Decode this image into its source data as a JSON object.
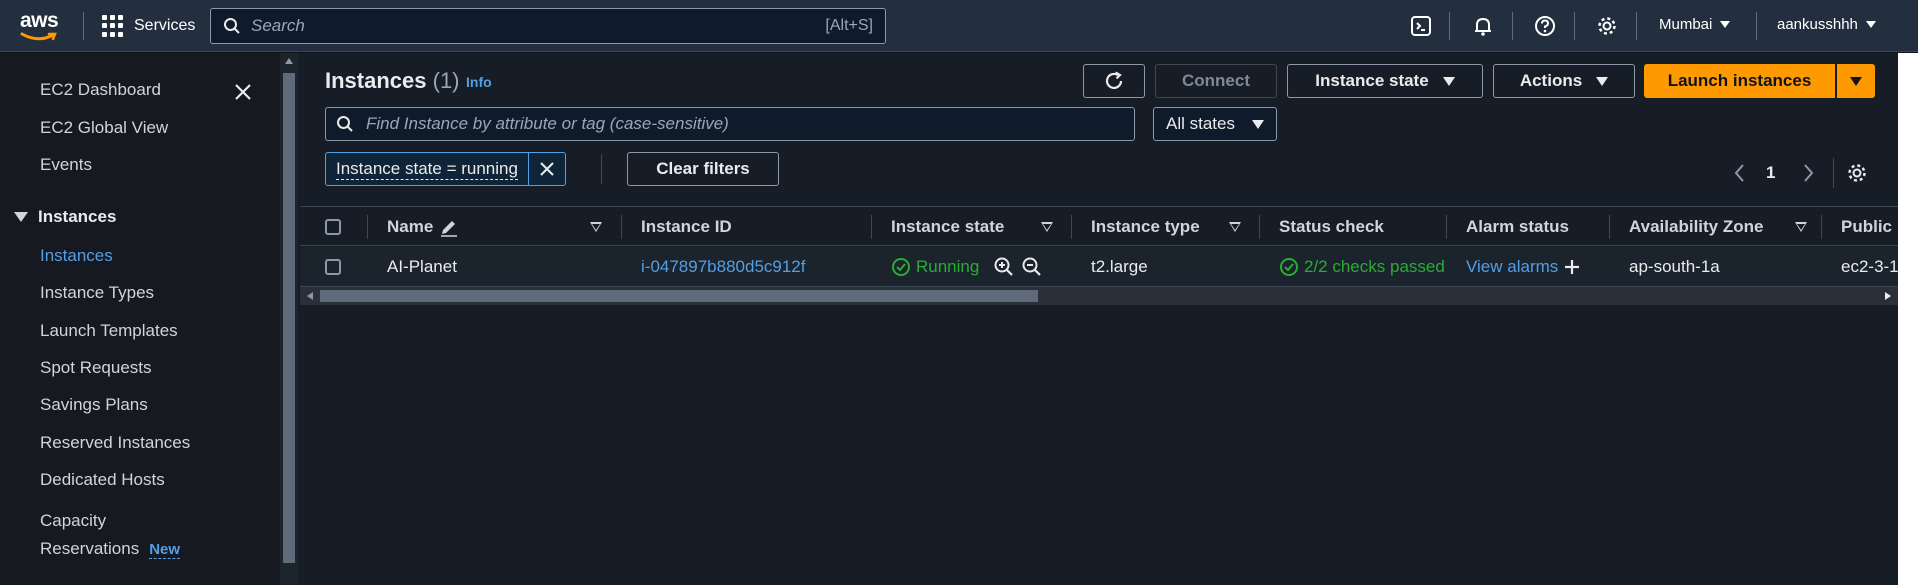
{
  "topnav": {
    "logo_text": "aws",
    "services_label": "Services",
    "search_placeholder": "Search",
    "search_shortcut": "[Alt+S]",
    "region": "Mumbai",
    "account": "aankusshhh"
  },
  "sidebar": {
    "items_top": [
      "EC2 Dashboard",
      "EC2 Global View",
      "Events"
    ],
    "section_label": "Instances",
    "section_items": [
      "Instances",
      "Instance Types",
      "Launch Templates",
      "Spot Requests",
      "Savings Plans",
      "Reserved Instances",
      "Dedicated Hosts"
    ],
    "capacity_line1": "Capacity",
    "capacity_line2": "Reservations",
    "new_badge": "New"
  },
  "header": {
    "title": "Instances",
    "count": "(1)",
    "info": "Info",
    "connect_label": "Connect",
    "instance_state_label": "Instance state",
    "actions_label": "Actions",
    "launch_label": "Launch instances"
  },
  "filters": {
    "find_placeholder": "Find Instance by attribute or tag (case-sensitive)",
    "states_select": "All states",
    "token": "Instance state = running",
    "clear_label": "Clear filters",
    "page_number": "1"
  },
  "table": {
    "columns": [
      "Name",
      "Instance ID",
      "Instance state",
      "Instance type",
      "Status check",
      "Alarm status",
      "Availability Zone",
      "Public"
    ],
    "row": {
      "name": "AI-Planet",
      "instance_id": "i-047897b880d5c912f",
      "state": "Running",
      "type": "t2.large",
      "status_check": "2/2 checks passed",
      "alarm": "View alarms",
      "az": "ap-south-1a",
      "public": "ec2-3-1"
    }
  },
  "colors": {
    "accent": "#ff9900",
    "link": "#539fe5",
    "success": "#29ad32",
    "nav_bg": "#232f3e"
  }
}
